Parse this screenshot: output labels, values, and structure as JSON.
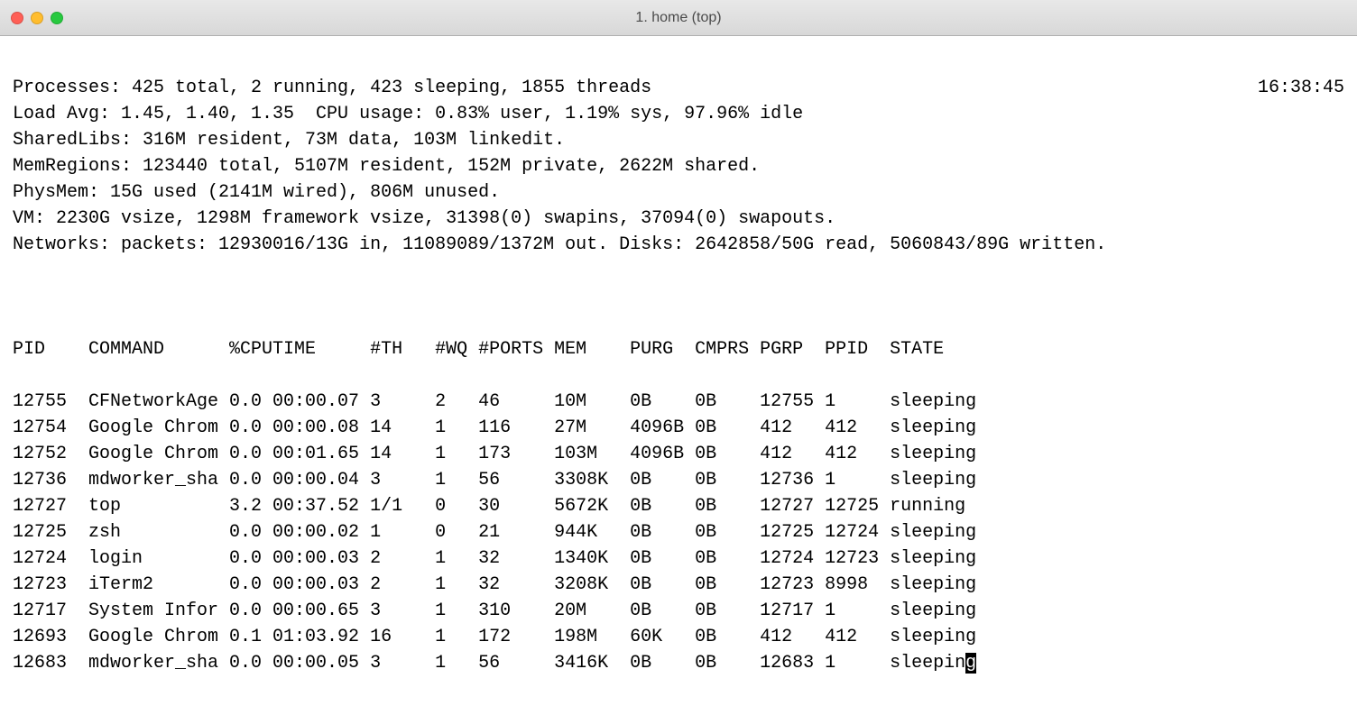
{
  "window": {
    "title": "1. home (top)"
  },
  "header": {
    "time": "16:38:45",
    "lines": [
      "Processes: 425 total, 2 running, 423 sleeping, 1855 threads",
      "Load Avg: 1.45, 1.40, 1.35  CPU usage: 0.83% user, 1.19% sys, 97.96% idle",
      "SharedLibs: 316M resident, 73M data, 103M linkedit.",
      "MemRegions: 123440 total, 5107M resident, 152M private, 2622M shared.",
      "PhysMem: 15G used (2141M wired), 806M unused.",
      "VM: 2230G vsize, 1298M framework vsize, 31398(0) swapins, 37094(0) swapouts.",
      "Networks: packets: 12930016/13G in, 11089089/1372M out. Disks: 2642858/50G read, 5060843/89G written."
    ]
  },
  "columns": [
    "PID",
    "COMMAND",
    "%CPU",
    "TIME",
    "#TH",
    "#WQ",
    "#PORTS",
    "MEM",
    "PURG",
    "CMPRS",
    "PGRP",
    "PPID",
    "STATE"
  ],
  "rows": [
    {
      "PID": "12755",
      "COMMAND": "CFNetworkAge",
      "CPU": "0.0",
      "TIME": "00:00.07",
      "TH": "3",
      "WQ": "2",
      "PORTS": "46",
      "MEM": "10M",
      "PURG": "0B",
      "CMPRS": "0B",
      "PGRP": "12755",
      "PPID": "1",
      "STATE": "sleeping"
    },
    {
      "PID": "12754",
      "COMMAND": "Google Chrom",
      "CPU": "0.0",
      "TIME": "00:00.08",
      "TH": "14",
      "WQ": "1",
      "PORTS": "116",
      "MEM": "27M",
      "PURG": "4096B",
      "CMPRS": "0B",
      "PGRP": "412",
      "PPID": "412",
      "STATE": "sleeping"
    },
    {
      "PID": "12752",
      "COMMAND": "Google Chrom",
      "CPU": "0.0",
      "TIME": "00:01.65",
      "TH": "14",
      "WQ": "1",
      "PORTS": "173",
      "MEM": "103M",
      "PURG": "4096B",
      "CMPRS": "0B",
      "PGRP": "412",
      "PPID": "412",
      "STATE": "sleeping"
    },
    {
      "PID": "12736",
      "COMMAND": "mdworker_sha",
      "CPU": "0.0",
      "TIME": "00:00.04",
      "TH": "3",
      "WQ": "1",
      "PORTS": "56",
      "MEM": "3308K",
      "PURG": "0B",
      "CMPRS": "0B",
      "PGRP": "12736",
      "PPID": "1",
      "STATE": "sleeping"
    },
    {
      "PID": "12727",
      "COMMAND": "top",
      "CPU": "3.2",
      "TIME": "00:37.52",
      "TH": "1/1",
      "WQ": "0",
      "PORTS": "30",
      "MEM": "5672K",
      "PURG": "0B",
      "CMPRS": "0B",
      "PGRP": "12727",
      "PPID": "12725",
      "STATE": "running"
    },
    {
      "PID": "12725",
      "COMMAND": "zsh",
      "CPU": "0.0",
      "TIME": "00:00.02",
      "TH": "1",
      "WQ": "0",
      "PORTS": "21",
      "MEM": "944K",
      "PURG": "0B",
      "CMPRS": "0B",
      "PGRP": "12725",
      "PPID": "12724",
      "STATE": "sleeping"
    },
    {
      "PID": "12724",
      "COMMAND": "login",
      "CPU": "0.0",
      "TIME": "00:00.03",
      "TH": "2",
      "WQ": "1",
      "PORTS": "32",
      "MEM": "1340K",
      "PURG": "0B",
      "CMPRS": "0B",
      "PGRP": "12724",
      "PPID": "12723",
      "STATE": "sleeping"
    },
    {
      "PID": "12723",
      "COMMAND": "iTerm2",
      "CPU": "0.0",
      "TIME": "00:00.03",
      "TH": "2",
      "WQ": "1",
      "PORTS": "32",
      "MEM": "3208K",
      "PURG": "0B",
      "CMPRS": "0B",
      "PGRP": "12723",
      "PPID": "8998",
      "STATE": "sleeping"
    },
    {
      "PID": "12717",
      "COMMAND": "System Infor",
      "CPU": "0.0",
      "TIME": "00:00.65",
      "TH": "3",
      "WQ": "1",
      "PORTS": "310",
      "MEM": "20M",
      "PURG": "0B",
      "CMPRS": "0B",
      "PGRP": "12717",
      "PPID": "1",
      "STATE": "sleeping"
    },
    {
      "PID": "12693",
      "COMMAND": "Google Chrom",
      "CPU": "0.1",
      "TIME": "01:03.92",
      "TH": "16",
      "WQ": "1",
      "PORTS": "172",
      "MEM": "198M",
      "PURG": "60K",
      "CMPRS": "0B",
      "PGRP": "412",
      "PPID": "412",
      "STATE": "sleeping"
    },
    {
      "PID": "12683",
      "COMMAND": "mdworker_sha",
      "CPU": "0.0",
      "TIME": "00:00.05",
      "TH": "3",
      "WQ": "1",
      "PORTS": "56",
      "MEM": "3416K",
      "PURG": "0B",
      "CMPRS": "0B",
      "PGRP": "12683",
      "PPID": "1",
      "STATE": "sleeping"
    }
  ],
  "widths": {
    "PID": 7,
    "COMMAND": 13,
    "CPU": 4,
    "TIME": 9,
    "TH": 6,
    "WQ": 4,
    "PORTS": 7,
    "MEM": 7,
    "PURG": 6,
    "CMPRS": 6,
    "PGRP": 6,
    "PPID": 6
  }
}
